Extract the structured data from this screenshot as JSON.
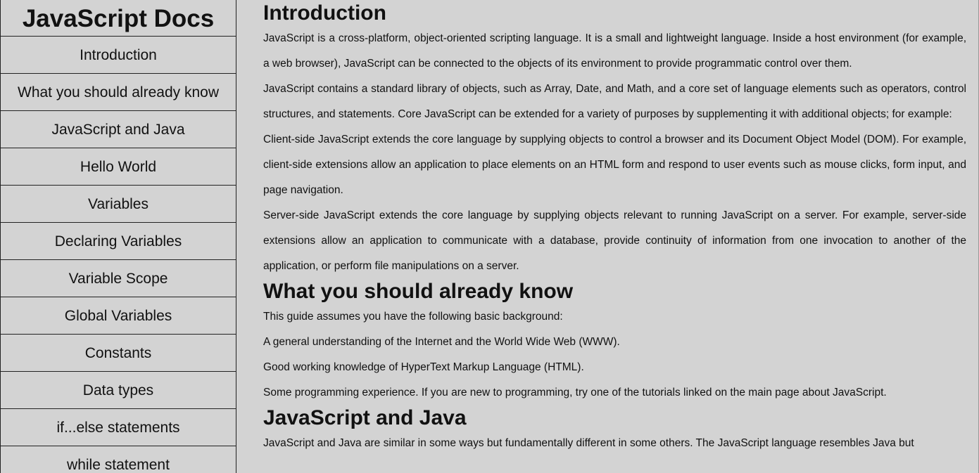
{
  "navbar": {
    "title": "JavaScript Docs",
    "items": [
      "Introduction",
      "What you should already know",
      "JavaScript and Java",
      "Hello World",
      "Variables",
      "Declaring Variables",
      "Variable Scope",
      "Global Variables",
      "Constants",
      "Data types",
      "if...else statements",
      "while statement"
    ]
  },
  "sections": {
    "introduction": {
      "title": "Introduction",
      "paragraphs": [
        "JavaScript is a cross-platform, object-oriented scripting language. It is a small and lightweight language. Inside a host environment (for example, a web browser), JavaScript can be connected to the objects of its environment to provide programmatic control over them.",
        "JavaScript contains a standard library of objects, such as Array, Date, and Math, and a core set of language elements such as operators, control structures, and statements. Core JavaScript can be extended for a variety of purposes by supplementing it with additional objects; for example:",
        "Client-side JavaScript extends the core language by supplying objects to control a browser and its Document Object Model (DOM). For example, client-side extensions allow an application to place elements on an HTML form and respond to user events such as mouse clicks, form input, and page navigation.",
        "Server-side JavaScript extends the core language by supplying objects relevant to running JavaScript on a server. For example, server-side extensions allow an application to communicate with a database, provide continuity of information from one invocation to another of the application, or perform file manipulations on a server."
      ]
    },
    "already_know": {
      "title": "What you should already know",
      "paragraphs": [
        "This guide assumes you have the following basic background:",
        "A general understanding of the Internet and the World Wide Web (WWW).",
        "Good working knowledge of HyperText Markup Language (HTML).",
        "Some programming experience. If you are new to programming, try one of the tutorials linked on the main page about JavaScript."
      ]
    },
    "js_and_java": {
      "title": "JavaScript and Java",
      "paragraphs": [
        "JavaScript and Java are similar in some ways but fundamentally different in some others. The JavaScript language resembles Java but"
      ]
    }
  }
}
